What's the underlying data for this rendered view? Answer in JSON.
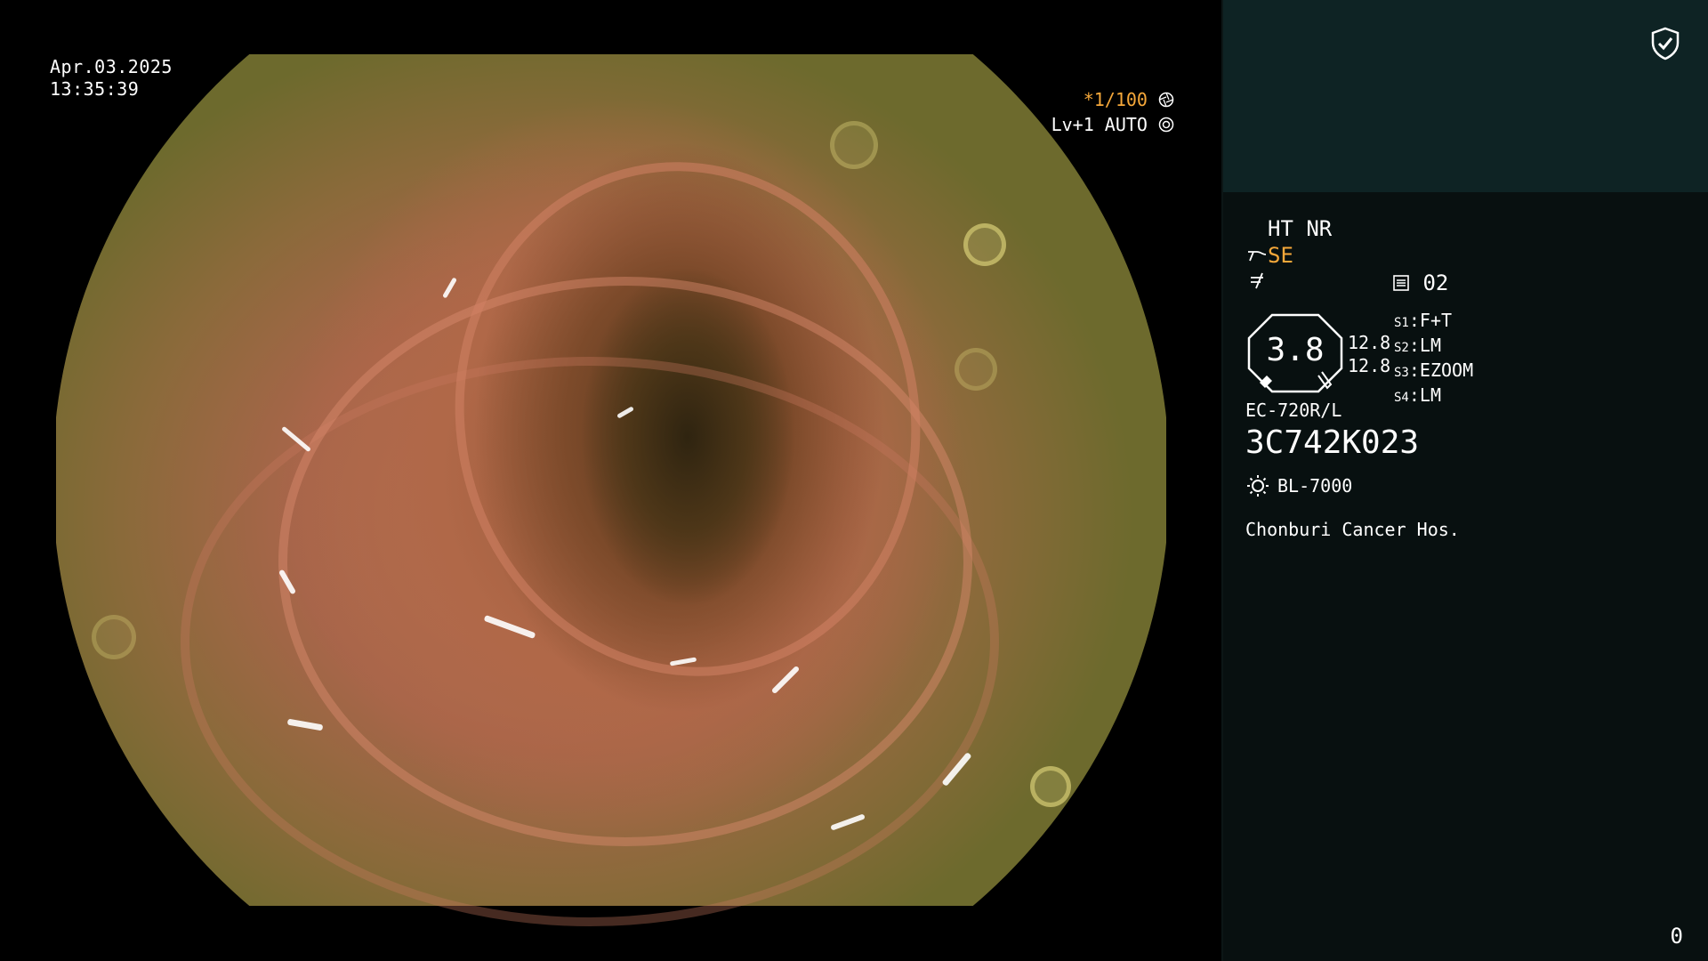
{
  "datetime": {
    "date": "Apr.03.2025",
    "time": "13:35:39"
  },
  "overlay": {
    "shutter_prefix": "*",
    "shutter": "1/100",
    "level_line": "Lv+1 AUTO"
  },
  "panel": {
    "ht_nr": "HT NR",
    "se": "SE",
    "number": "02",
    "gauge_value": "3.8",
    "aperture_1": "12.8",
    "aperture_2": "12.8",
    "slots": [
      {
        "label": "S1",
        "value": "F+T"
      },
      {
        "label": "S2",
        "value": "LM"
      },
      {
        "label": "S3",
        "value": "EZOOM"
      },
      {
        "label": "S4",
        "value": "LM"
      }
    ],
    "scope_model": "EC-720R/L",
    "scope_serial": "3C742K023",
    "light_source": "BL-7000",
    "hospital": "Chonburi Cancer Hos.",
    "counter": "0"
  },
  "colors": {
    "accent": "#f6a83a",
    "panel_top": "#0e2324",
    "panel_bg": "#081010"
  },
  "icons": [
    "shield-check-icon",
    "aperture-icon",
    "iris-icon",
    "scope-icon",
    "filter-icon",
    "memory-icon",
    "light-source-icon"
  ]
}
